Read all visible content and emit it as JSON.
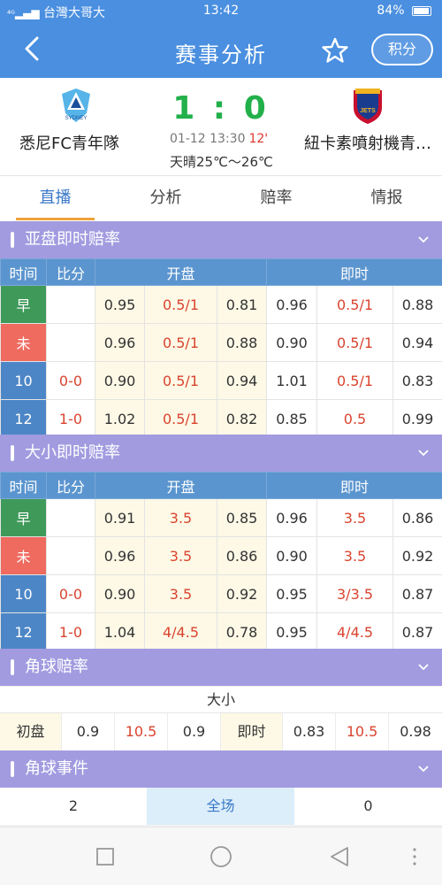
{
  "status_bar": {
    "signal": "⁴ᴳ",
    "carrier": "台灣大哥大",
    "time": "13:42",
    "battery": "84%"
  },
  "header": {
    "title": "赛事分析",
    "points_button": "积分"
  },
  "match": {
    "home_team": "悉尼FC青年隊",
    "away_team": "紐卡素噴射機青…",
    "score": "1 : 0",
    "datetime": "01-12 13:30",
    "minute": "12'",
    "weather": "天晴25℃～26℃",
    "home_logo_text": "SYDNEY",
    "away_logo_text": "JETS"
  },
  "tabs": [
    {
      "label": "直播",
      "active": true
    },
    {
      "label": "分析",
      "active": false
    },
    {
      "label": "赔率",
      "active": false
    },
    {
      "label": "情报",
      "active": false
    }
  ],
  "asian_handicap": {
    "title": "亚盘即时赔率",
    "headers": {
      "time": "时间",
      "score": "比分",
      "open": "开盘",
      "live": "即时"
    },
    "rows": [
      {
        "time": "早",
        "type": "early",
        "score": "",
        "o1": "0.95",
        "oh": "0.5/1",
        "o2": "0.81",
        "l1": "0.96",
        "lh": "0.5/1",
        "l2": "0.88"
      },
      {
        "time": "未",
        "type": "late",
        "score": "",
        "o1": "0.96",
        "oh": "0.5/1",
        "o2": "0.88",
        "l1": "0.90",
        "lh": "0.5/1",
        "l2": "0.94"
      },
      {
        "time": "10",
        "type": "minute",
        "score": "0-0",
        "o1": "0.90",
        "oh": "0.5/1",
        "o2": "0.94",
        "l1": "1.01",
        "lh": "0.5/1",
        "l2": "0.83"
      },
      {
        "time": "12",
        "type": "minute",
        "score": "1-0",
        "o1": "1.02",
        "oh": "0.5/1",
        "o2": "0.82",
        "l1": "0.85",
        "lh": "0.5",
        "l2": "0.99"
      }
    ]
  },
  "over_under": {
    "title": "大小即时赔率",
    "headers": {
      "time": "时间",
      "score": "比分",
      "open": "开盘",
      "live": "即时"
    },
    "rows": [
      {
        "time": "早",
        "type": "early",
        "score": "",
        "o1": "0.91",
        "oh": "3.5",
        "o2": "0.85",
        "l1": "0.96",
        "lh": "3.5",
        "l2": "0.86"
      },
      {
        "time": "未",
        "type": "late",
        "score": "",
        "o1": "0.96",
        "oh": "3.5",
        "o2": "0.86",
        "l1": "0.90",
        "lh": "3.5",
        "l2": "0.92"
      },
      {
        "time": "10",
        "type": "minute",
        "score": "0-0",
        "o1": "0.90",
        "oh": "3.5",
        "o2": "0.92",
        "l1": "0.95",
        "lh": "3/3.5",
        "l2": "0.87"
      },
      {
        "time": "12",
        "type": "minute",
        "score": "1-0",
        "o1": "1.04",
        "oh": "4/4.5",
        "o2": "0.78",
        "l1": "0.95",
        "lh": "4/4.5",
        "l2": "0.87"
      }
    ]
  },
  "corner_odds": {
    "title": "角球赔率",
    "subtitle": "大小",
    "initial_label": "初盘",
    "i1": "0.9",
    "ih": "10.5",
    "i2": "0.9",
    "live_label": "即时",
    "l1": "0.83",
    "lh": "10.5",
    "l2": "0.98"
  },
  "corner_events": {
    "title": "角球事件",
    "home": "2",
    "label": "全场",
    "away": "0"
  },
  "colors": {
    "header_blue": "#4a8fe0",
    "section_purple": "#a29be0",
    "score_green": "#22b04b",
    "handicap_red": "#d9442f"
  }
}
